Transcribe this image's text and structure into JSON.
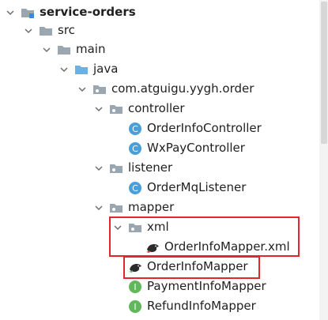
{
  "project_tree": {
    "items": [
      {
        "label": "service-orders",
        "icon": "module-folder-icon",
        "expanded": true,
        "depth": 0
      },
      {
        "label": "src",
        "icon": "folder-icon",
        "expanded": true,
        "depth": 1
      },
      {
        "label": "main",
        "icon": "folder-icon",
        "expanded": true,
        "depth": 2
      },
      {
        "label": "java",
        "icon": "source-folder-icon",
        "expanded": true,
        "depth": 3
      },
      {
        "label": "com.atguigu.yygh.order",
        "icon": "package-icon",
        "expanded": true,
        "depth": 4
      },
      {
        "label": "controller",
        "icon": "package-icon",
        "expanded": true,
        "depth": 5
      },
      {
        "label": "OrderInfoController",
        "icon": "class-icon",
        "depth": 6
      },
      {
        "label": "WxPayController",
        "icon": "class-icon",
        "depth": 6
      },
      {
        "label": "listener",
        "icon": "package-icon",
        "expanded": true,
        "depth": 5
      },
      {
        "label": "OrderMqListener",
        "icon": "class-icon",
        "depth": 6
      },
      {
        "label": "mapper",
        "icon": "package-icon",
        "expanded": true,
        "depth": 5
      },
      {
        "label": "xml",
        "icon": "package-icon",
        "expanded": true,
        "depth": 6
      },
      {
        "label": "OrderInfoMapper.xml",
        "icon": "mybatis-bird-icon",
        "depth": 7
      },
      {
        "label": "OrderInfoMapper",
        "icon": "mybatis-bird-icon",
        "depth": 6
      },
      {
        "label": "PaymentInfoMapper",
        "icon": "interface-icon",
        "depth": 6
      },
      {
        "label": "RefundInfoMapper",
        "icon": "interface-icon",
        "depth": 6
      }
    ]
  },
  "colors": {
    "highlight_border": "#e3262d",
    "class_icon": "#4a9fd8",
    "interface_icon": "#5fb85a",
    "folder": "#9aa7b0",
    "source_folder": "#6eb1e1"
  },
  "icon_glyphs": {
    "class_letter": "C",
    "interface_letter": "I"
  }
}
